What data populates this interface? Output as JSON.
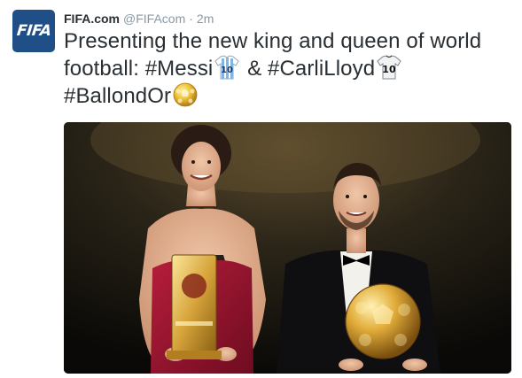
{
  "author": {
    "name": "FIFA.com",
    "handle": "@FIFAcom",
    "separator": "·",
    "timestamp": "2m",
    "avatar_text": "FIFA"
  },
  "tweet": {
    "text_part1": "Presenting the new king and queen of world football: ",
    "hashtag_messi": "#Messi",
    "text_part2": " & ",
    "hashtag_lloyd": "#CarliLloyd",
    "hashtag_ballon": "#BallondOr"
  },
  "icons": {
    "messi_shirt": "argentina-shirt-10-emoji",
    "lloyd_shirt": "usa-shirt-10-emoji",
    "ball": "golden-ball-emoji"
  },
  "colors": {
    "name": "#292f33",
    "meta": "#8899a6",
    "avatar_bg": "#1f4f86"
  }
}
